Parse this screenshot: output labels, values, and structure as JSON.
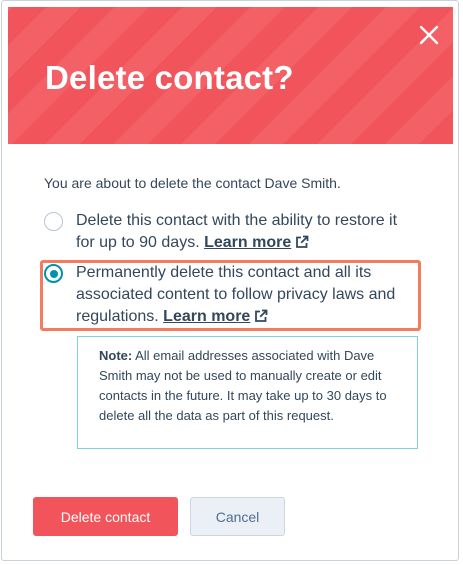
{
  "dialog": {
    "title": "Delete contact?",
    "intro": "You are about to delete the contact Dave Smith.",
    "options": [
      {
        "text": "Delete this contact with the ability to restore it for up to 90 days.",
        "link": "Learn more",
        "selected": false
      },
      {
        "text": "Permanently delete this contact and all its associated content to follow privacy laws and regulations.",
        "link": "Learn more",
        "selected": true
      }
    ],
    "note": {
      "label": "Note:",
      "text": "All email addresses associated with Dave Smith may not be used to manually create or edit contacts in the future. It may take up to 30 days to delete all the data as part of this request."
    },
    "buttons": {
      "delete": "Delete contact",
      "cancel": "Cancel"
    }
  },
  "icons": {
    "close": "close-icon",
    "external_link": "external-link-icon"
  },
  "colors": {
    "header": "#f2545b",
    "primary_button": "#f2545b",
    "radio_selected": "#0091ae",
    "highlight_border": "#f47c5e",
    "note_border": "#7fd1de",
    "text": "#33475b"
  }
}
